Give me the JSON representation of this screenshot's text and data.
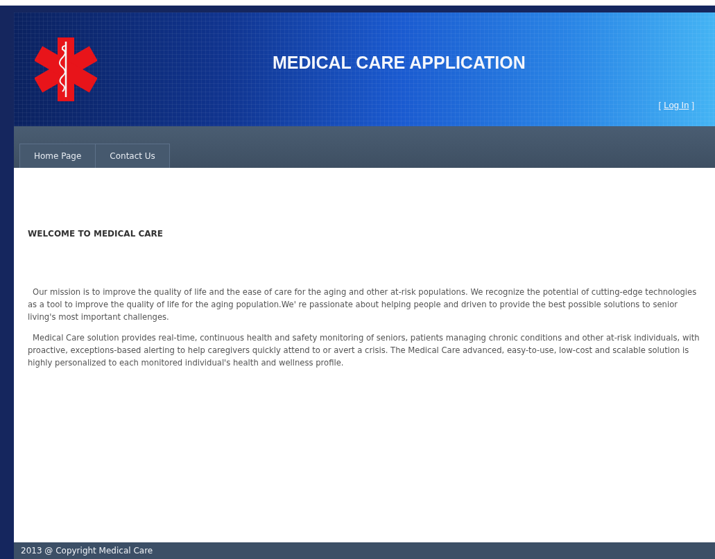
{
  "header": {
    "title": "MEDICAL CARE APPLICATION",
    "login": {
      "open": "[",
      "link": "Log In",
      "close": "]"
    }
  },
  "nav": {
    "tabs": [
      {
        "label": "Home Page"
      },
      {
        "label": "Contact Us"
      }
    ]
  },
  "content": {
    "heading": "WELCOME TO MEDICAL CARE",
    "paragraphs": [
      "Our mission is to improve the quality of life and the ease of care for the aging and other at-risk populations. We recognize the potential of cutting-edge technologies as a tool to improve the quality of life for the aging population.We' re passionate about helping people and driven to provide the best possible solutions to senior living's most important challenges.",
      "Medical Care solution provides real-time, continuous health and safety monitoring of seniors, patients managing chronic conditions and other at-risk individuals, with proactive, exceptions-based alerting to help caregivers quickly attend to or avert a crisis. The Medical Care advanced, easy-to-use, low-cost and scalable solution is highly personalized to each monitored individual's health and wellness profile."
    ]
  },
  "footer": {
    "text": "2013 @ Copyright Medical Care"
  }
}
